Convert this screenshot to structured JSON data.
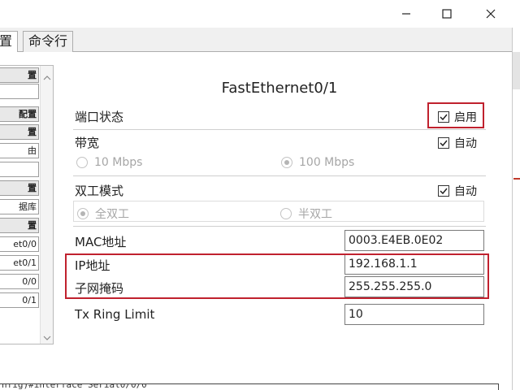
{
  "window": {
    "controls": [
      "minimize-icon",
      "maximize-icon",
      "close-icon"
    ]
  },
  "tabs": [
    {
      "label": "置",
      "active": true
    },
    {
      "label": "命令行",
      "active": false
    }
  ],
  "sidebar": {
    "items": [
      {
        "label": "置",
        "kind": "header"
      },
      {
        "label": "",
        "kind": "sub"
      },
      {
        "label": "配置",
        "kind": "header"
      },
      {
        "label": "置",
        "kind": "header"
      },
      {
        "label": "由",
        "kind": "sub"
      },
      {
        "label": "",
        "kind": "sub"
      },
      {
        "label": "置",
        "kind": "header"
      },
      {
        "label": "据库",
        "kind": "sub"
      },
      {
        "label": "置",
        "kind": "header"
      },
      {
        "label": "et0/0",
        "kind": "sub"
      },
      {
        "label": "et0/1",
        "kind": "sub"
      },
      {
        "label": "0/0",
        "kind": "sub"
      },
      {
        "label": "0/1",
        "kind": "sub"
      }
    ]
  },
  "panel": {
    "title": "FastEthernet0/1",
    "port_status": {
      "label": "端口状态",
      "checkbox_label": "启用",
      "checked": true
    },
    "bandwidth": {
      "label": "带宽",
      "auto_label": "自动",
      "auto_checked": true,
      "options": [
        {
          "label": "10 Mbps",
          "selected": false
        },
        {
          "label": "100 Mbps",
          "selected": true
        }
      ]
    },
    "duplex": {
      "label": "双工模式",
      "auto_label": "自动",
      "auto_checked": true,
      "options": [
        {
          "label": "全双工",
          "selected": true
        },
        {
          "label": "半双工",
          "selected": false
        }
      ]
    },
    "mac": {
      "label": "MAC地址",
      "value": "0003.E4EB.0E02"
    },
    "ip": {
      "label": "IP地址",
      "value": "192.168.1.1"
    },
    "mask": {
      "label": "子网掩码",
      "value": "255.255.255.0"
    },
    "tx_ring": {
      "label": "Tx Ring Limit",
      "value": "10"
    }
  },
  "console": {
    "text": "nfig)#interface Serial0/0/0"
  },
  "colors": {
    "highlight": "#c0212e",
    "disabled_text": "#a6a6a6"
  }
}
